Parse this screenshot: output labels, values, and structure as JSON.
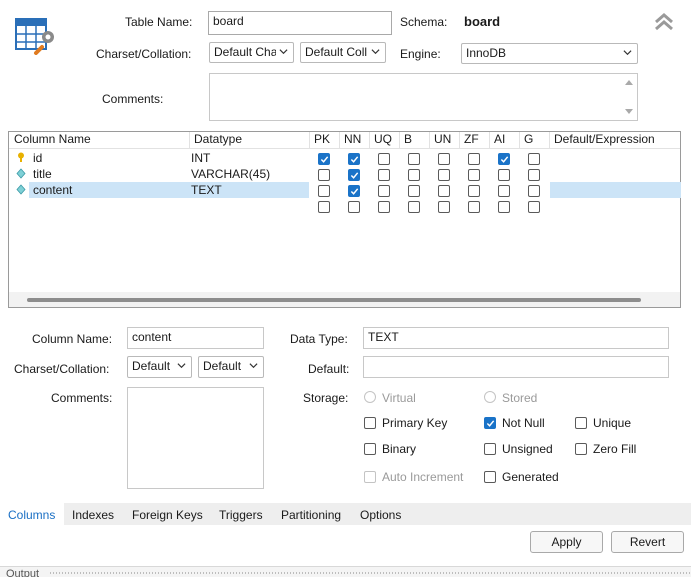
{
  "header": {
    "table_name_label": "Table Name:",
    "table_name": "board",
    "schema_label": "Schema:",
    "schema": "board",
    "charset_label": "Charset/Collation:",
    "charset_value": "Default Chars",
    "collation_value": "Default Coll",
    "engine_label": "Engine:",
    "engine_value": "InnoDB",
    "comments_label": "Comments:"
  },
  "grid": {
    "columns": [
      "Column Name",
      "Datatype",
      "PK",
      "NN",
      "UQ",
      "B",
      "UN",
      "ZF",
      "AI",
      "G",
      "Default/Expression"
    ],
    "rows": [
      {
        "name": "id",
        "type": "INT",
        "key_icon": "key-icon",
        "flags": [
          true,
          true,
          false,
          false,
          false,
          false,
          true,
          false
        ]
      },
      {
        "name": "title",
        "type": "VARCHAR(45)",
        "key_icon": "diamond-icon",
        "flags": [
          false,
          true,
          false,
          false,
          false,
          false,
          false,
          false
        ]
      },
      {
        "name": "content",
        "type": "TEXT",
        "key_icon": "diamond-icon",
        "flags": [
          false,
          true,
          false,
          false,
          false,
          false,
          false,
          false
        ]
      },
      {
        "name": "",
        "type": "",
        "key_icon": "",
        "flags": [
          false,
          false,
          false,
          false,
          false,
          false,
          false,
          false
        ]
      }
    ]
  },
  "detail": {
    "column_name_label": "Column Name:",
    "column_name": "content",
    "data_type_label": "Data Type:",
    "data_type": "TEXT",
    "charset_label": "Charset/Collation:",
    "charset_value": "Default",
    "collation_value": "Default",
    "default_label": "Default:",
    "comments_label": "Comments:",
    "storage_label": "Storage:",
    "virtual": "Virtual",
    "stored": "Stored",
    "primary_key": "Primary Key",
    "not_null": "Not Null",
    "unique": "Unique",
    "binary": "Binary",
    "unsigned": "Unsigned",
    "zero_fill": "Zero Fill",
    "auto_increment": "Auto Increment",
    "generated": "Generated"
  },
  "tabs": [
    "Columns",
    "Indexes",
    "Foreign Keys",
    "Triggers",
    "Partitioning",
    "Options"
  ],
  "buttons": {
    "apply": "Apply",
    "revert": "Revert"
  },
  "output_label": "Output",
  "colors": {
    "accent": "#1a73c8",
    "selection": "#cce4f7",
    "tabbar": "#eeeeee"
  }
}
